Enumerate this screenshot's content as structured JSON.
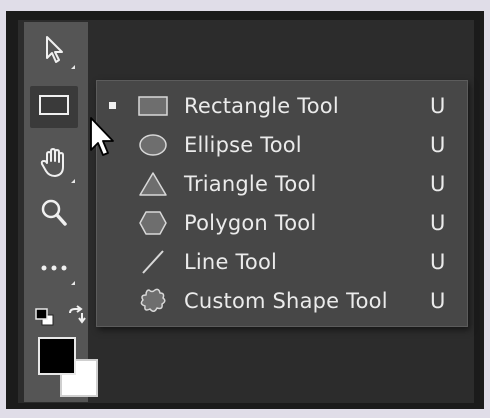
{
  "menu": {
    "items": [
      {
        "icon": "rectangle-icon",
        "label": "Rectangle Tool",
        "shortcut": "U",
        "selected": true
      },
      {
        "icon": "ellipse-icon",
        "label": "Ellipse Tool",
        "shortcut": "U",
        "selected": false
      },
      {
        "icon": "triangle-icon",
        "label": "Triangle Tool",
        "shortcut": "U",
        "selected": false
      },
      {
        "icon": "polygon-icon",
        "label": "Polygon Tool",
        "shortcut": "U",
        "selected": false
      },
      {
        "icon": "line-icon",
        "label": "Line Tool",
        "shortcut": "U",
        "selected": false
      },
      {
        "icon": "custom-shape-icon",
        "label": "Custom Shape Tool",
        "shortcut": "U",
        "selected": false
      }
    ]
  },
  "toolbar": {
    "tools": [
      {
        "icon": "move-arrow-icon"
      },
      {
        "icon": "rectangle-icon",
        "active": true
      },
      {
        "icon": "hand-icon"
      },
      {
        "icon": "zoom-icon"
      },
      {
        "icon": "more-tools-icon"
      }
    ]
  },
  "colors": {
    "foreground": "#000000",
    "background": "#ffffff",
    "panel": "#555555",
    "flyout": "#474747",
    "text": "#ebebeb"
  }
}
